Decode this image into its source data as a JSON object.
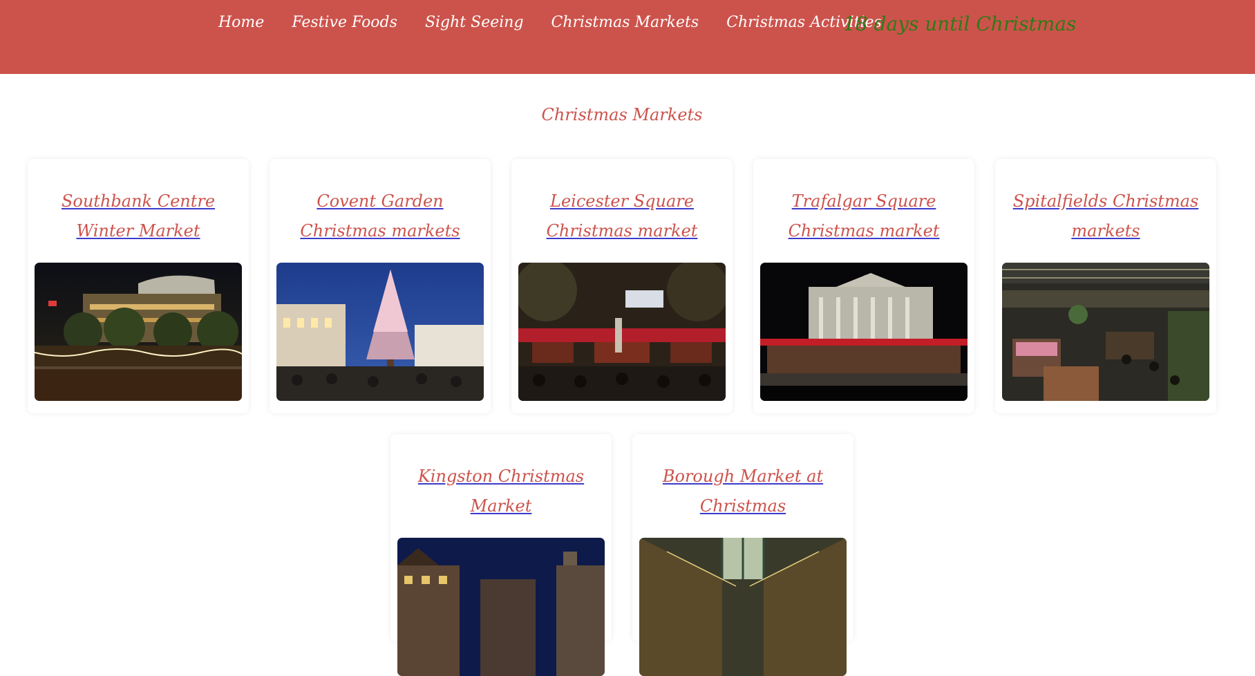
{
  "nav": {
    "links": [
      {
        "label": "Home"
      },
      {
        "label": "Festive Foods"
      },
      {
        "label": "Sight Seeing"
      },
      {
        "label": "Christmas Markets"
      },
      {
        "label": "Christmas Activities"
      }
    ],
    "countdown": "18 days until Christmas"
  },
  "page": {
    "title": "Christmas Markets"
  },
  "markets": [
    {
      "name": "Southbank Centre Winter Market"
    },
    {
      "name": "Covent Garden Christmas markets"
    },
    {
      "name": "Leicester Square Christmas market"
    },
    {
      "name": "Trafalgar Square Christmas market"
    },
    {
      "name": "Spitalfields Christmas markets"
    },
    {
      "name": "Kingston Christmas Market"
    },
    {
      "name": "Borough Market at Christmas"
    }
  ],
  "colors": {
    "nav_background": "#cc534c",
    "countdown": "#2f7a16",
    "accent": "#cc534c",
    "link_underline": "#3b3bcc"
  }
}
